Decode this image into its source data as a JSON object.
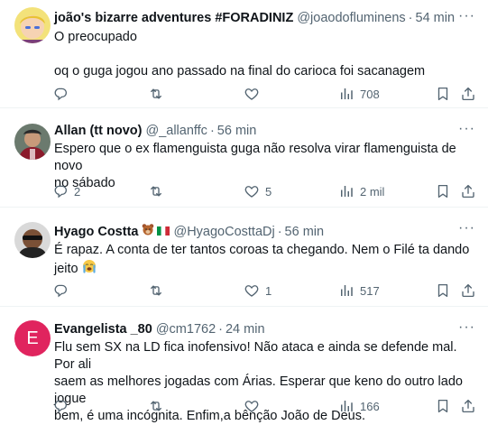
{
  "tweets": [
    {
      "name": "joão's bizarre adventures #FORADINIZ",
      "handle": "@joaodofluminens",
      "time": "54 min",
      "line1": "O preocupado",
      "line2": "oq o guga jogou ano passado na final do carioca foi sacanagem",
      "replies": "",
      "retweets": "",
      "likes": "",
      "views": "708"
    },
    {
      "name": "Allan (tt novo)",
      "handle": "@_allanffc",
      "time": "56 min",
      "line1": "Espero que o ex flamenguista guga não resolva virar flamenguista de novo",
      "line2": "no sábado",
      "replies": "2",
      "retweets": "",
      "likes": "5",
      "views": "2 mil"
    },
    {
      "name": "Hyago Costta",
      "handle": "@HyagoCosttaDj",
      "time": "56 min",
      "line1": "É rapaz. A conta de ter tantos coroas ta chegando. Nem o Filé ta dando",
      "line2": "jeito",
      "replies": "",
      "retweets": "",
      "likes": "1",
      "views": "517"
    },
    {
      "name": "Evangelista _80",
      "handle": "@cm1762",
      "time": "24 min",
      "avatar_letter": "E",
      "line1": "Flu sem SX na LD fica inofensivo! Não ataca e ainda se defende mal. Por ali",
      "line2": "saem as melhores jogadas com Árias. Esperar que keno do outro lado jogue",
      "line3": "bem, é uma incógnita. Enfim,a bênção João de Deus.",
      "replies": "",
      "retweets": "",
      "likes": "",
      "views": "166"
    }
  ],
  "separator": "·",
  "more_label": "···",
  "colors": {
    "text": "#0f1419",
    "secondary": "#536471",
    "divider": "#eff3f4",
    "avatar_e": "#e0245e"
  },
  "icons": [
    "reply-icon",
    "retweet-icon",
    "like-icon",
    "views-icon",
    "bookmark-icon",
    "share-icon",
    "more-icon",
    "crying-face-icon",
    "bear-emoji-icon",
    "italy-flag-icon"
  ]
}
